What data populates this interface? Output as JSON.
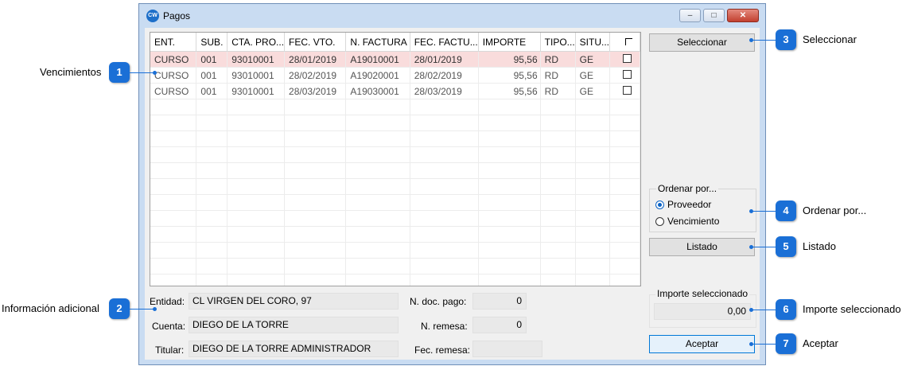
{
  "window": {
    "title": "Pagos",
    "app_icon": "app-logo-icon"
  },
  "table": {
    "columns": [
      "ENT.",
      "SUB.",
      "CTA. PRO...",
      "FEC. VTO.",
      "N. FACTURA",
      "FEC. FACTU...",
      "IMPORTE",
      "TIPO...",
      "SITU..."
    ],
    "rows": [
      [
        "CURSO",
        "001",
        "93010001",
        "28/01/2019",
        "A19010001",
        "28/01/2019",
        "95,56",
        "RD",
        "GE"
      ],
      [
        "CURSO",
        "001",
        "93010001",
        "28/02/2019",
        "A19020001",
        "28/02/2019",
        "95,56",
        "RD",
        "GE"
      ],
      [
        "CURSO",
        "001",
        "93010001",
        "28/03/2019",
        "A19030001",
        "28/03/2019",
        "95,56",
        "RD",
        "GE"
      ]
    ]
  },
  "buttons": {
    "seleccionar": "Seleccionar",
    "listado": "Listado",
    "aceptar": "Aceptar"
  },
  "order": {
    "title": "Ordenar por...",
    "option1": "Proveedor",
    "option2": "Vencimiento"
  },
  "importe": {
    "title": "Importe seleccionado",
    "value": "0,00"
  },
  "info": {
    "entidad_label": "Entidad:",
    "entidad_value": "CL VIRGEN DEL CORO, 97",
    "cuenta_label": "Cuenta:",
    "cuenta_value": "DIEGO DE LA TORRE",
    "titular_label": "Titular:",
    "titular_value": "DIEGO DE LA TORRE ADMINISTRADOR",
    "ndoc_label": "N. doc. pago:",
    "ndoc_value": "0",
    "nremesa_label": "N. remesa:",
    "nremesa_value": "0",
    "fecremesa_label": "Fec. remesa:",
    "fecremesa_value": ""
  },
  "callouts": {
    "c1": {
      "num": "1",
      "text": "Vencimientos"
    },
    "c2": {
      "num": "2",
      "text": "Información adicional"
    },
    "c3": {
      "num": "3",
      "text": "Seleccionar"
    },
    "c4": {
      "num": "4",
      "text": "Ordenar por..."
    },
    "c5": {
      "num": "5",
      "text": "Listado"
    },
    "c6": {
      "num": "6",
      "text": "Importe seleccionado"
    },
    "c7": {
      "num": "7",
      "text": "Aceptar"
    }
  },
  "colors": {
    "callout": "#1a6fd6",
    "selected_row": "#f9dcdc",
    "window_frame": "#c9dcf2"
  }
}
